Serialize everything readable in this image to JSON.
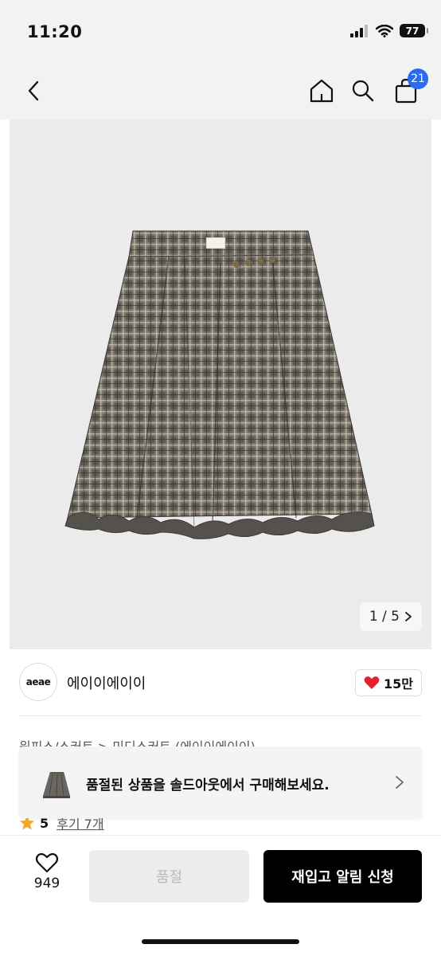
{
  "status_bar": {
    "time": "11:20",
    "battery": "77"
  },
  "nav": {
    "cart_count": "21"
  },
  "gallery": {
    "counter": "1 / 5"
  },
  "brand": {
    "logo_text": "aeae",
    "name": "에이이에이이",
    "likes": "15만"
  },
  "breadcrumb": {
    "text": "원피스/스커트 > 미디스커트 (에이이에이이)"
  },
  "soldout_banner": {
    "message": "품절된 상품을 솔드아웃에서 구매해보세요."
  },
  "rating": {
    "score": "5",
    "reviews": "후기 7개"
  },
  "bottom_bar": {
    "wish_count": "949",
    "soldout_label": "품절",
    "restock_label": "재입고 알림 신청"
  },
  "colors": {
    "accent": "#2b6bf3",
    "like_red": "#e4202c",
    "star": "#f5a623",
    "primary_button": "#000000"
  }
}
